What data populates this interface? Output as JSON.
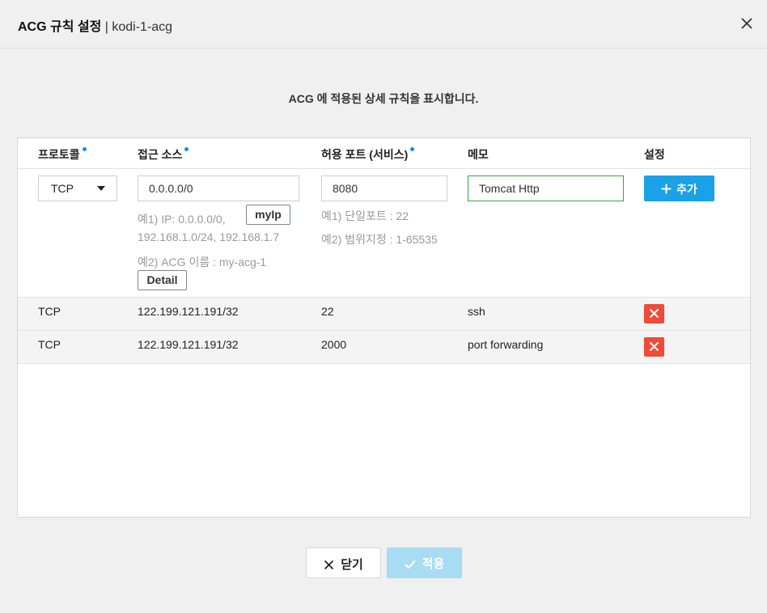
{
  "header": {
    "title": "ACG 규칙 설정",
    "separator": " | ",
    "acg_name": "kodi-1-acg"
  },
  "description": "ACG 에 적용된 상세 규칙을 표시합니다.",
  "table": {
    "columns": [
      "프로토콜",
      "접근 소스",
      "허용 포트 (서비스)",
      "메모",
      "설정"
    ],
    "required_columns": [
      "프로토콜",
      "접근 소스",
      "허용 포트 (서비스)"
    ],
    "input_row": {
      "protocol": "TCP",
      "source": "0.0.0.0/0",
      "port": "8080",
      "memo": "Tomcat Http",
      "add_label": "추가",
      "source_hint_1": "예1) IP: 0.0.0.0/0,",
      "source_hint_2": "192.168.1.0/24, 192.168.1.7",
      "source_hint_3": "예2) ACG 이름 : my-acg-1",
      "myip_label": "myIp",
      "detail_label": "Detail",
      "port_hint_1": "예1) 단일포트 : 22",
      "port_hint_2": "예2) 범위지정 : 1-65535"
    },
    "rows": [
      {
        "protocol": "TCP",
        "source": "122.199.121.191/32",
        "port": "22",
        "memo": "ssh"
      },
      {
        "protocol": "TCP",
        "source": "122.199.121.191/32",
        "port": "2000",
        "memo": "port forwarding"
      }
    ]
  },
  "footer": {
    "close_label": "닫기",
    "apply_label": "적용"
  },
  "colors": {
    "accent": "#1aa1e8",
    "required_dot": "#1a8de0",
    "delete": "#ee4b38",
    "memo_focus_border": "#2eaa3c",
    "apply_disabled": "#a8dcf2"
  },
  "icons": [
    "close-icon",
    "plus-icon",
    "delete-icon",
    "check-icon",
    "dropdown-caret-icon"
  ]
}
